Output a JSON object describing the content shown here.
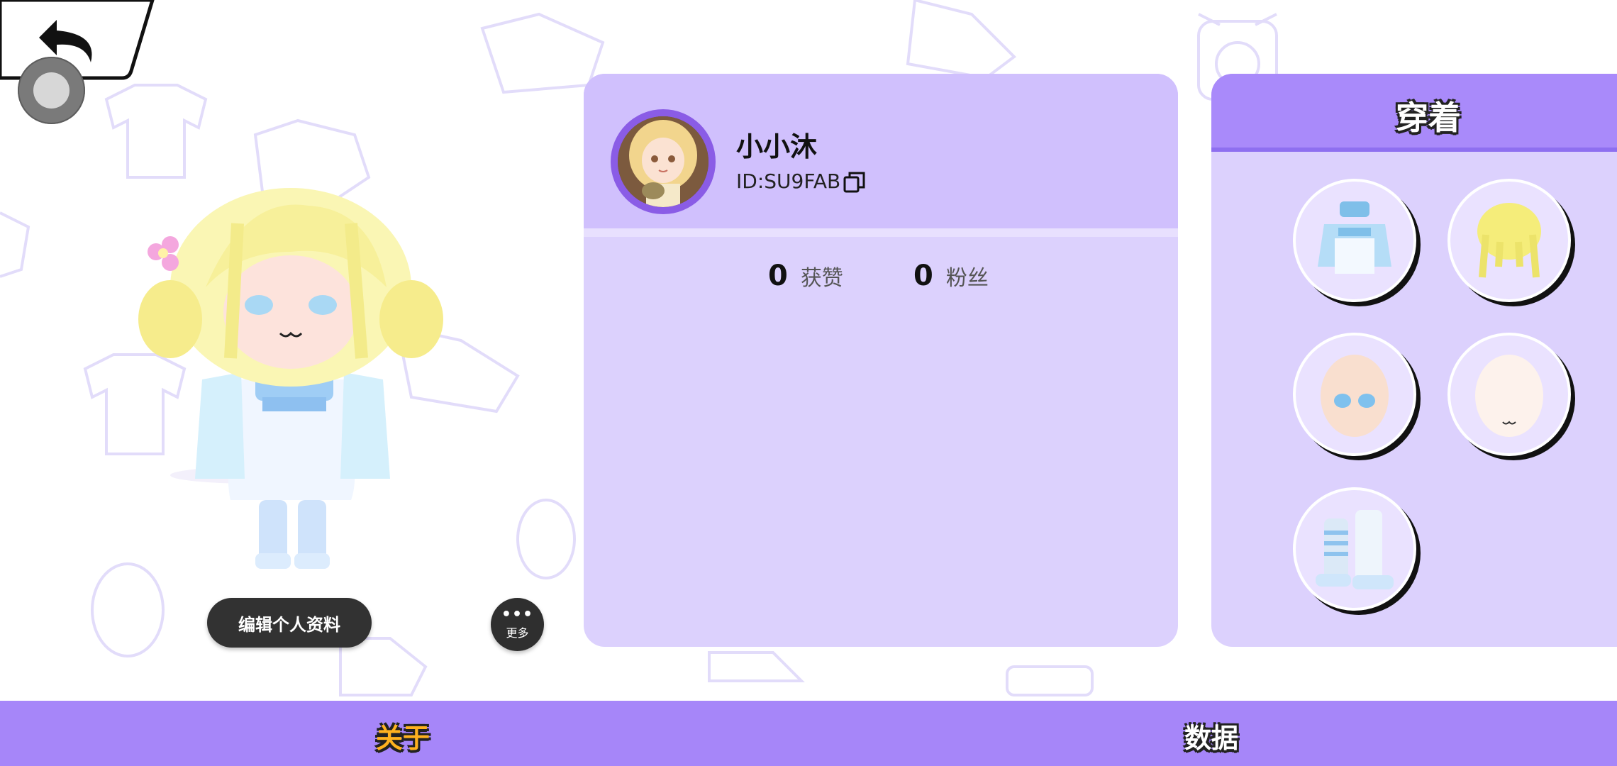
{
  "profile": {
    "username": "小小沐",
    "id_text": "ID:SU9FAB",
    "likes_count": "0",
    "likes_label": "获赞",
    "fans_count": "0",
    "fans_label": "粉丝"
  },
  "actions": {
    "edit_profile_label": "编辑个人资料",
    "more_dots": "•••",
    "more_label": "更多"
  },
  "wearing": {
    "title": "穿着",
    "items": [
      {
        "name": "outfit-item-dress-icon"
      },
      {
        "name": "outfit-item-hair-icon"
      },
      {
        "name": "outfit-item-face-eyes-icon"
      },
      {
        "name": "outfit-item-face-mouth-icon"
      },
      {
        "name": "outfit-item-boots-icon"
      }
    ]
  },
  "tabs": {
    "about": "关于",
    "data": "数据"
  },
  "colors": {
    "accent_purple": "#a686f9",
    "card_light": "#dcd1fd",
    "card_header": "#d0c0fd",
    "active_tab": "#ffb21f"
  }
}
